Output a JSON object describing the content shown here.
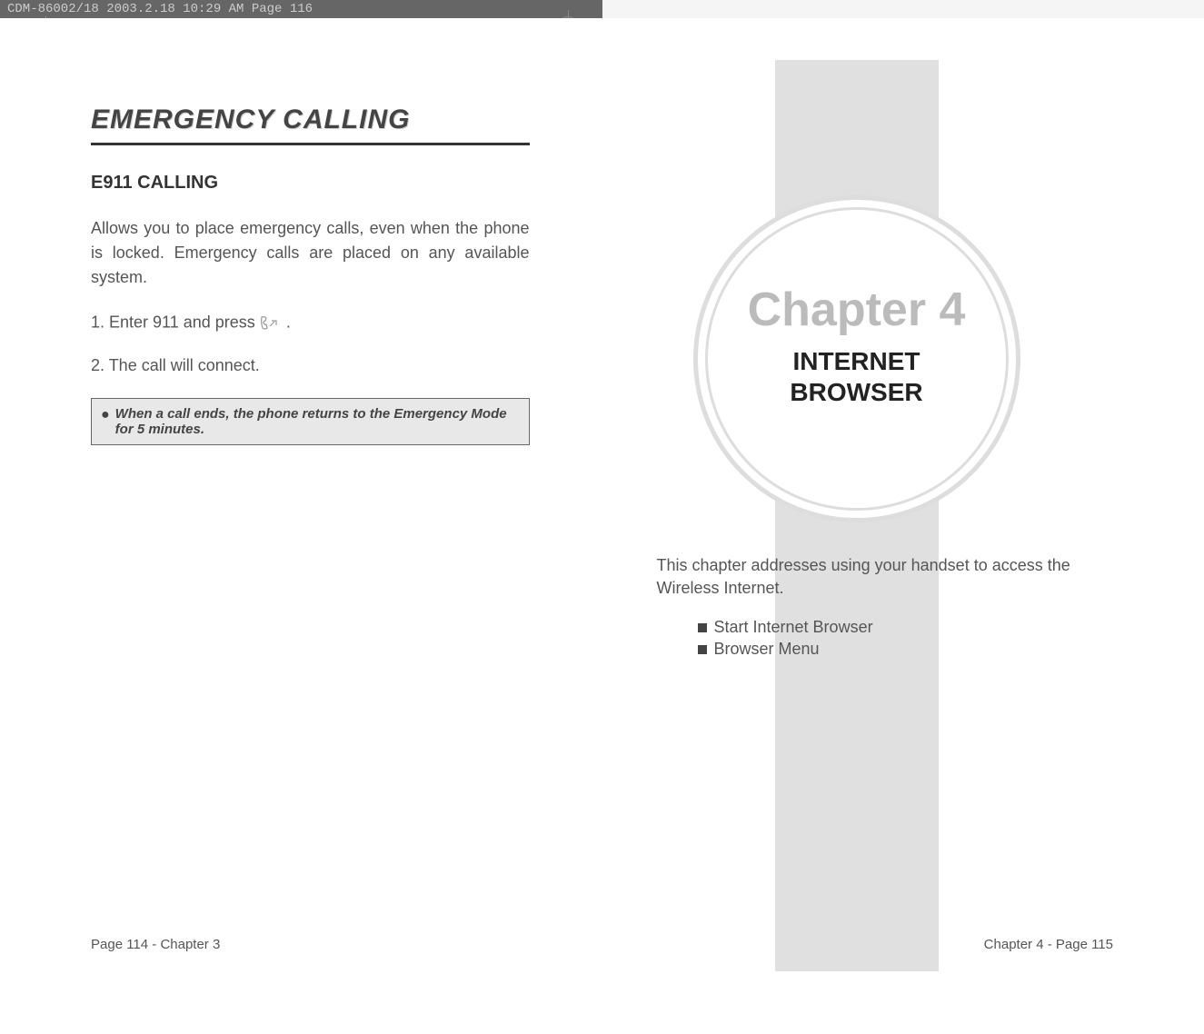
{
  "print_header": "CDM-86002/18  2003.2.18  10:29 AM  Page 116",
  "left_page": {
    "chapter_heading": "EMERGENCY CALLING",
    "section_title": "E911 CALLING",
    "intro": "Allows you to place emergency calls, even when the phone is locked. Emergency calls are placed on any available system.",
    "step1_prefix": "1. Enter 911 and press ",
    "step1_suffix": " .",
    "step2": "2. The call will connect.",
    "note": "When a call ends, the phone returns to the Emergency Mode for 5 minutes.",
    "footer": "Page 114 - Chapter 3"
  },
  "right_page": {
    "chapter_number": "Chapter 4",
    "chapter_title_line1": "INTERNET",
    "chapter_title_line2": "BROWSER",
    "description": "This chapter addresses using your handset to access the Wireless Internet.",
    "toc": [
      "Start Internet Browser",
      "Browser Menu"
    ],
    "footer": "Chapter 4 - Page 115"
  }
}
